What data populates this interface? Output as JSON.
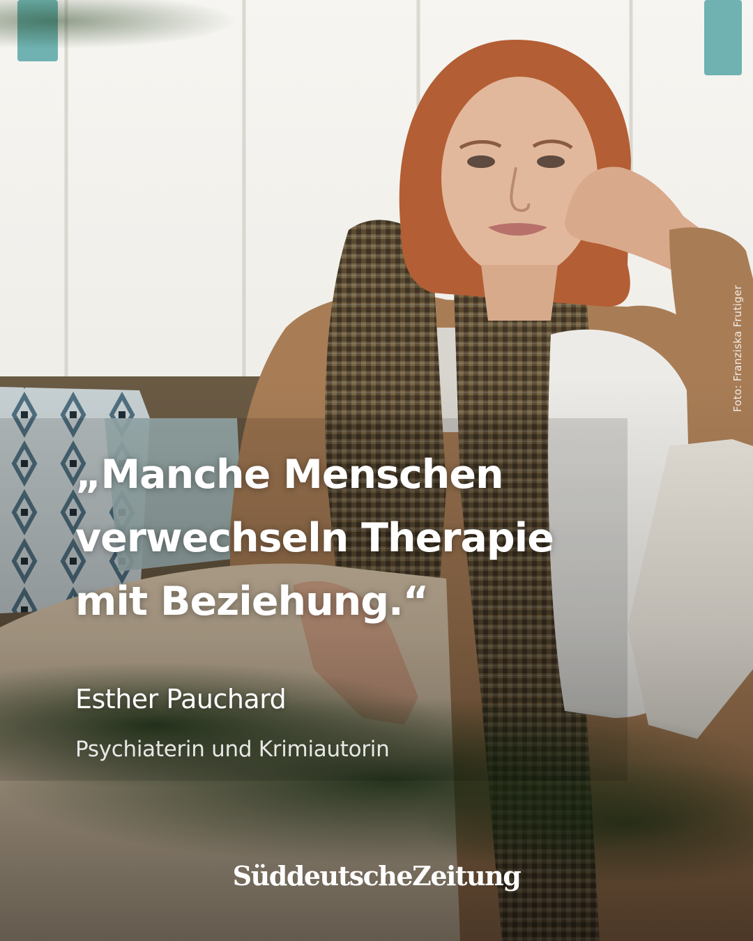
{
  "photo": {
    "credit": "Foto: Franziska Frutiger"
  },
  "quote": {
    "lines": [
      "„Manche Menschen",
      "verwechseln Therapie",
      "mit Beziehung.“"
    ]
  },
  "person": {
    "name": "Esther Pauchard",
    "role": "Psychiaterin und Krimiautorin"
  },
  "brand": {
    "logo_text": "SüddeutscheZeitung"
  },
  "colors": {
    "text": "#ffffff",
    "wall": "#f4f3ef",
    "hair": "#b35e34",
    "cardigan": "#a87d56",
    "scarf": "#5b4b33",
    "foliage": "#1f3a18"
  }
}
